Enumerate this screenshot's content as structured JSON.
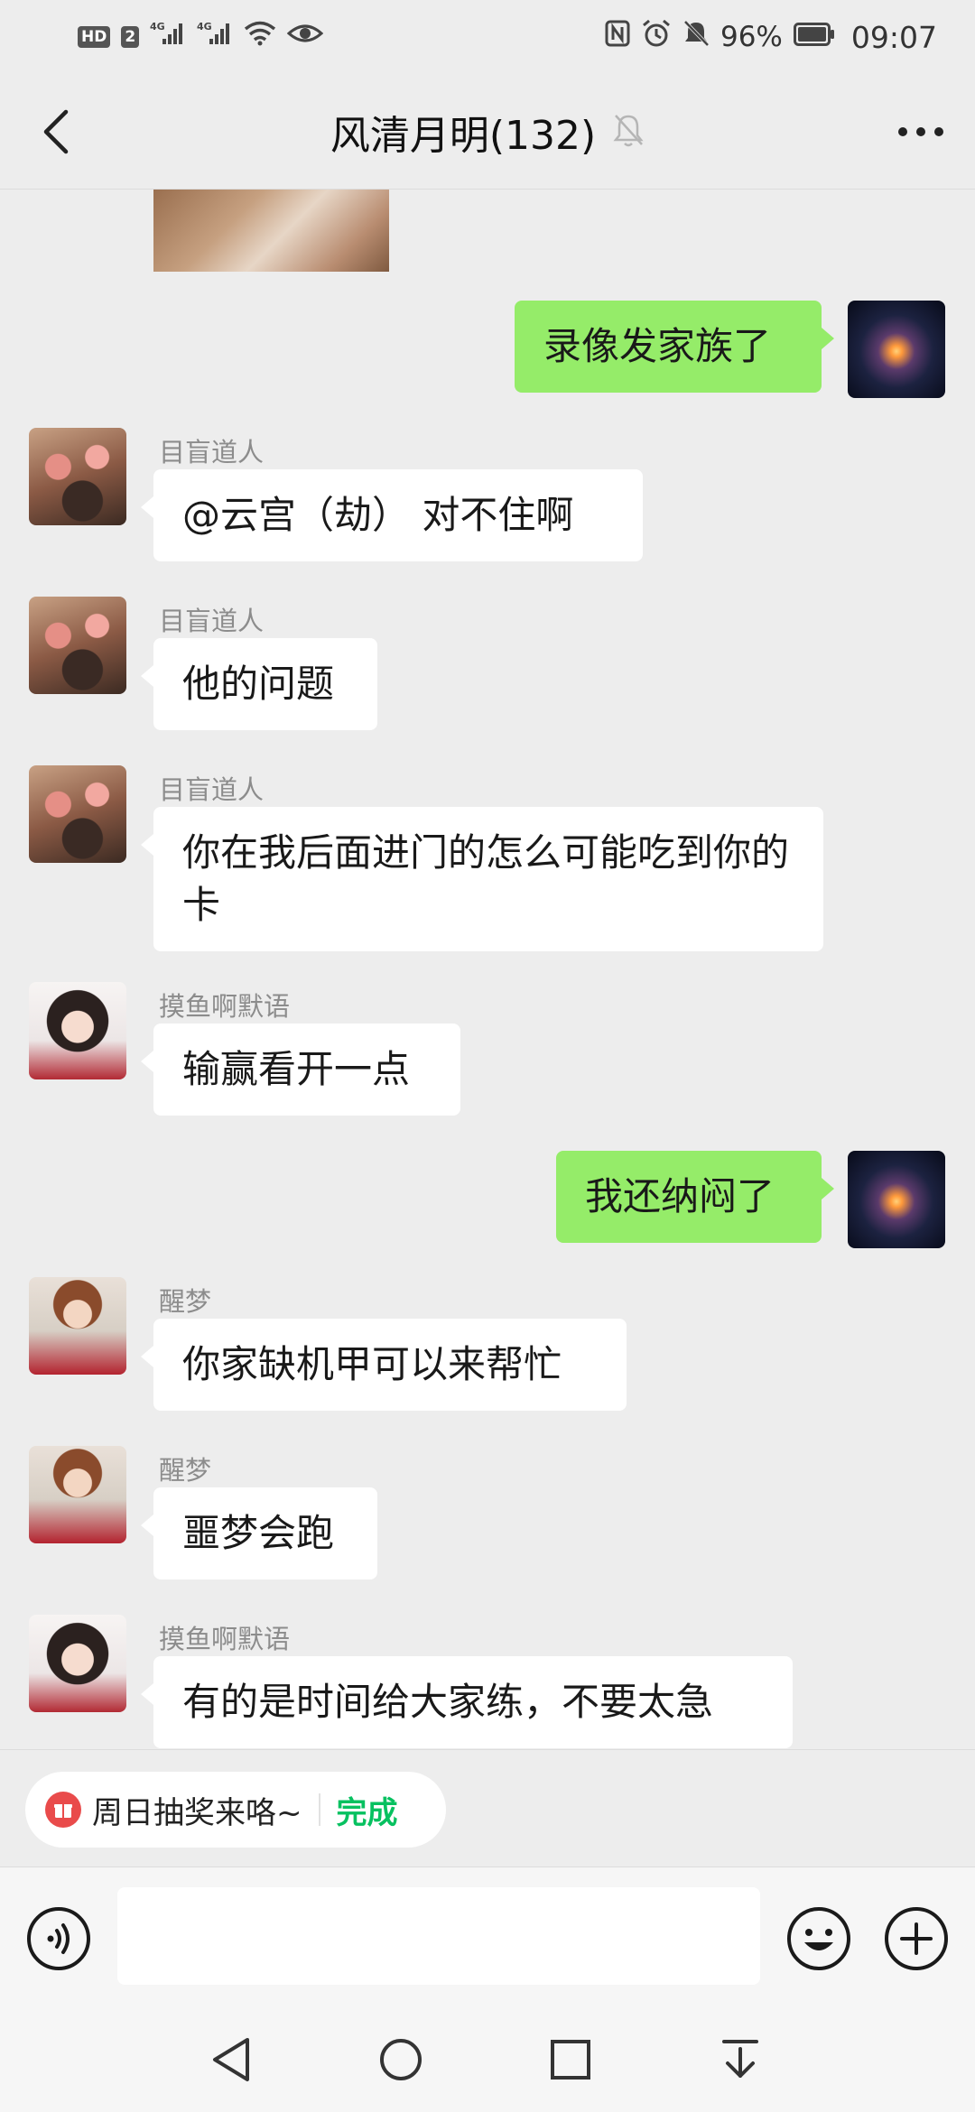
{
  "status_bar": {
    "hd_label": "HD",
    "sim_label": "2",
    "network_1": "4G",
    "network_2": "4G",
    "battery_text": "96%",
    "time": "09:07"
  },
  "header": {
    "title": "风清月明(132)",
    "icons": {
      "back": "back-arrow-icon",
      "mute": "bell-off-icon",
      "more": "more-dots-icon"
    }
  },
  "messages": [
    {
      "type": "image",
      "direction": "in",
      "content": "photo"
    },
    {
      "type": "text",
      "direction": "out",
      "text": "录像发家族了"
    },
    {
      "type": "text",
      "direction": "in",
      "sender": "目盲道人",
      "text": "@云宫（劫） 对不住啊"
    },
    {
      "type": "text",
      "direction": "in",
      "sender": "目盲道人",
      "text": "他的问题"
    },
    {
      "type": "text",
      "direction": "in",
      "sender": "目盲道人",
      "text": "你在我后面进门的怎么可能吃到你的卡"
    },
    {
      "type": "text",
      "direction": "in",
      "sender": "摸鱼啊默语",
      "text": "输赢看开一点"
    },
    {
      "type": "text",
      "direction": "out",
      "text": "我还纳闷了"
    },
    {
      "type": "text",
      "direction": "in",
      "sender": "醒梦",
      "text": "你家缺机甲可以来帮忙"
    },
    {
      "type": "text",
      "direction": "in",
      "sender": "醒梦",
      "text": "噩梦会跑"
    },
    {
      "type": "text",
      "direction": "in",
      "sender": "摸鱼啊默语",
      "text": "有的是时间给大家练，不要太急"
    }
  ],
  "quick_action": {
    "icon": "gift-icon",
    "text": "周日抽奖来咯~",
    "action": "完成",
    "accent": "#07c160"
  },
  "input_bar": {
    "value": "",
    "icons": {
      "voice": "voice-icon",
      "emoji": "emoji-icon",
      "plus": "plus-circle-icon"
    }
  },
  "colors": {
    "background": "#ededed",
    "bubble_out": "#95ec69",
    "bubble_in": "#ffffff",
    "sender_name": "#8c8c8c"
  }
}
